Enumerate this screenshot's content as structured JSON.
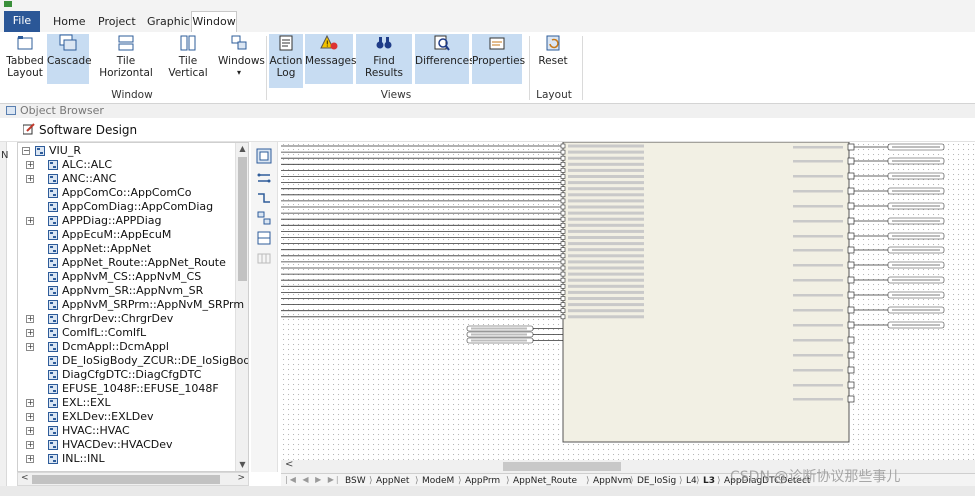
{
  "ribbon": {
    "tabs": [
      "File",
      "Home",
      "Project",
      "Graphic",
      "Window"
    ],
    "active_tab": "Window",
    "buttons": {
      "tabbed_layout": "Tabbed\nLayout",
      "cascade": "Cascade",
      "tile_horizontal": "Tile Horizontal",
      "tile_vertical": "Tile Vertical",
      "windows": "Windows",
      "action_log": "Action\nLog",
      "messages": "Messages",
      "find_results": "Find Results",
      "differences": "Differences",
      "properties": "Properties",
      "reset": "Reset"
    },
    "groups": [
      "Window",
      "Views",
      "Layout"
    ]
  },
  "object_browser": {
    "title": "Object Browser"
  },
  "software_design": {
    "title": "Software Design"
  },
  "tree": {
    "items": [
      {
        "label": "VIU_R",
        "expander": "−",
        "level": 0
      },
      {
        "label": "ALC::ALC",
        "expander": "+",
        "level": 1
      },
      {
        "label": "ANC::ANC",
        "expander": "+",
        "level": 1
      },
      {
        "label": "AppComCo::AppComCo",
        "expander": "",
        "level": 1
      },
      {
        "label": "AppComDiag::AppComDiag",
        "expander": "",
        "level": 1
      },
      {
        "label": "APPDiag::APPDiag",
        "expander": "+",
        "level": 1
      },
      {
        "label": "AppEcuM::AppEcuM",
        "expander": "",
        "level": 1
      },
      {
        "label": "AppNet::AppNet",
        "expander": "",
        "level": 1
      },
      {
        "label": "AppNet_Route::AppNet_Route",
        "expander": "",
        "level": 1
      },
      {
        "label": "AppNvM_CS::AppNvM_CS",
        "expander": "",
        "level": 1
      },
      {
        "label": "AppNvm_SR::AppNvm_SR",
        "expander": "",
        "level": 1
      },
      {
        "label": "AppNvM_SRPrm::AppNvM_SRPrm",
        "expander": "",
        "level": 1
      },
      {
        "label": "ChrgrDev::ChrgrDev",
        "expander": "+",
        "level": 1
      },
      {
        "label": "ComIfL::ComIfL",
        "expander": "+",
        "level": 1
      },
      {
        "label": "DcmAppl::DcmAppl",
        "expander": "+",
        "level": 1
      },
      {
        "label": "DE_IoSigBody_ZCUR::DE_IoSigBody_Z",
        "expander": "",
        "level": 1
      },
      {
        "label": "DiagCfgDTC::DiagCfgDTC",
        "expander": "",
        "level": 1
      },
      {
        "label": "EFUSE_1048F::EFUSE_1048F",
        "expander": "",
        "level": 1
      },
      {
        "label": "EXL::EXL",
        "expander": "+",
        "level": 1
      },
      {
        "label": "EXLDev::EXLDev",
        "expander": "+",
        "level": 1
      },
      {
        "label": "HVAC::HVAC",
        "expander": "+",
        "level": 1
      },
      {
        "label": "HVACDev::HVACDev",
        "expander": "+",
        "level": 1
      },
      {
        "label": "INL::INL",
        "expander": "+",
        "level": 1
      }
    ]
  },
  "left_edge_letter": "N",
  "bottom_tabs": [
    "BSW",
    "AppNet",
    "ModeM",
    "AppPrm",
    "AppNet_Route",
    "AppNvm",
    "DE_IoSig",
    "L4",
    "L3",
    "AppDiagDTCDetect"
  ],
  "active_bottom_tab": "L3",
  "watermark": "CSDN @诊断协议那些事儿",
  "colors": {
    "file_tab": "#2b5797",
    "selected": "#c7dcf2",
    "component_fill": "#f2f0e4"
  }
}
